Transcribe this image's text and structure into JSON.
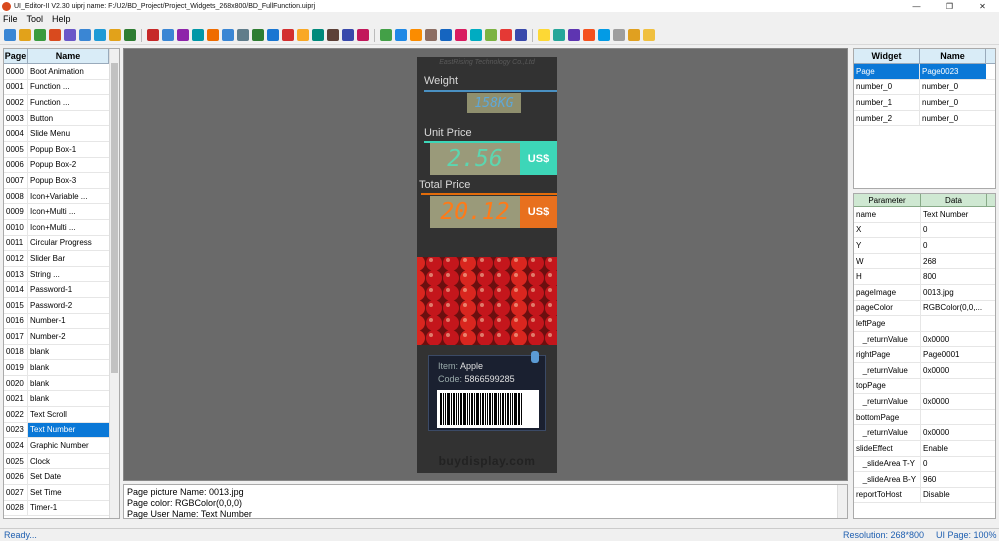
{
  "window": {
    "title": "UI_Editor-II V2.30   uiprj name: F:/U2/BD_Project/Project_Widgets_268x800/BD_FullFunction.uiprj",
    "minimize": "—",
    "maximize": "❐",
    "close": "✕"
  },
  "menu": [
    "File",
    "Tool",
    "Help"
  ],
  "toolbar_colors": [
    "#3a86d4",
    "#e2a21a",
    "#3b9b3e",
    "#d94a1e",
    "#6a58c8",
    "#3a86d4",
    "#1f9ad6",
    "#e2a21a",
    "#2e7d32",
    "#c62828",
    "#3a86d4",
    "#8e24aa",
    "#0097a7",
    "#ef6c00",
    "#3a86d4",
    "#607d8b",
    "#2e7d32",
    "#1976d2",
    "#d32f2f",
    "#f9a825",
    "#00897b",
    "#5d4037",
    "#3949ab",
    "#c2185b",
    "#43a047",
    "#1e88e5",
    "#fb8c00",
    "#8d6e63",
    "#1565c0",
    "#d81b60",
    "#00acc1",
    "#7cb342",
    "#e53935",
    "#3949ab",
    "#fdd835",
    "#26a69a",
    "#5e35b1",
    "#f4511e",
    "#039be5",
    "#9e9e9e",
    "#e0a020",
    "#f0c040"
  ],
  "page_list": {
    "headers": [
      "Page",
      "Name"
    ],
    "rows": [
      [
        "0000",
        "Boot Animation"
      ],
      [
        "0001",
        "Function ..."
      ],
      [
        "0002",
        "Function ..."
      ],
      [
        "0003",
        "Button"
      ],
      [
        "0004",
        "Slide Menu"
      ],
      [
        "0005",
        "Popup  Box-1"
      ],
      [
        "0006",
        "Popup  Box-2"
      ],
      [
        "0007",
        "Popup  Box-3"
      ],
      [
        "0008",
        "Icon+Variable ..."
      ],
      [
        "0009",
        "Icon+Multi ..."
      ],
      [
        "0010",
        "Icon+Multi ..."
      ],
      [
        "0011",
        "Circular Progress"
      ],
      [
        "0012",
        "Slider Bar"
      ],
      [
        "0013",
        "String ..."
      ],
      [
        "0014",
        "Password-1"
      ],
      [
        "0015",
        "Password-2"
      ],
      [
        "0016",
        "Number-1"
      ],
      [
        "0017",
        "Number-2"
      ],
      [
        "0018",
        "blank"
      ],
      [
        "0019",
        "blank"
      ],
      [
        "0020",
        "blank"
      ],
      [
        "0021",
        "blank"
      ],
      [
        "0022",
        "Text Scroll"
      ],
      [
        "0023",
        "Text Number"
      ],
      [
        "0024",
        "Graphic Number"
      ],
      [
        "0025",
        "Clock"
      ],
      [
        "0026",
        "Set Date"
      ],
      [
        "0027",
        "Set Time"
      ],
      [
        "0028",
        "Timer-1"
      ]
    ],
    "selected_index": 23
  },
  "screen": {
    "brand": "EastRising Technology Co.,Ltd",
    "weight_label": "Weight",
    "weight_value": "158KG",
    "unit_price_label": "Unit Price",
    "unit_price_value": "2.56",
    "unit_price_unit": "US$",
    "total_price_label": "Total Price",
    "total_price_value": "20.12",
    "total_price_unit": "US$",
    "item_label": "Item:",
    "item_value": "Apple",
    "code_label": "Code:",
    "code_value": "5866599285",
    "watermark": "buydisplay.com",
    "colors": {
      "cyan": "#3dd6b8",
      "orange": "#e8701e",
      "green_digits": "#5cd6b0",
      "orange_digits": "#ff7a18"
    }
  },
  "log": {
    "lines": [
      "Page picture Name: 0013.jpg",
      "Page color: RGBColor(0,0,0)",
      "Page User Name: Text Number"
    ]
  },
  "widgets": {
    "headers": [
      "Widget",
      "Name"
    ],
    "rows": [
      [
        "Page",
        "Page0023"
      ],
      [
        "number_0",
        "number_0"
      ],
      [
        "number_1",
        "number_0"
      ],
      [
        "number_2",
        "number_0"
      ]
    ],
    "selected_index": 0
  },
  "params": {
    "headers": [
      "Parameter",
      "Data"
    ],
    "rows": [
      [
        "name",
        "Text Number"
      ],
      [
        "X",
        "0"
      ],
      [
        "Y",
        "0"
      ],
      [
        "W",
        "268"
      ],
      [
        "H",
        "800"
      ],
      [
        "pageImage",
        "0013.jpg"
      ],
      [
        "pageColor",
        "RGBColor(0,0,..."
      ],
      [
        "leftPage",
        ""
      ],
      [
        "   _returnValue",
        "0x0000"
      ],
      [
        "rightPage",
        "Page0001"
      ],
      [
        "   _returnValue",
        "0x0000"
      ],
      [
        "topPage",
        ""
      ],
      [
        "   _returnValue",
        "0x0000"
      ],
      [
        "bottomPage",
        ""
      ],
      [
        "   _returnValue",
        "0x0000"
      ],
      [
        "slideEffect",
        "Enable"
      ],
      [
        "   _slideArea T-Y",
        "0"
      ],
      [
        "   _slideArea B-Y",
        "960"
      ],
      [
        "reportToHost",
        "Disable"
      ]
    ]
  },
  "status": {
    "left": "Ready...",
    "resolution": "Resolution: 268*800",
    "ui_page": "UI Page: 100%"
  }
}
